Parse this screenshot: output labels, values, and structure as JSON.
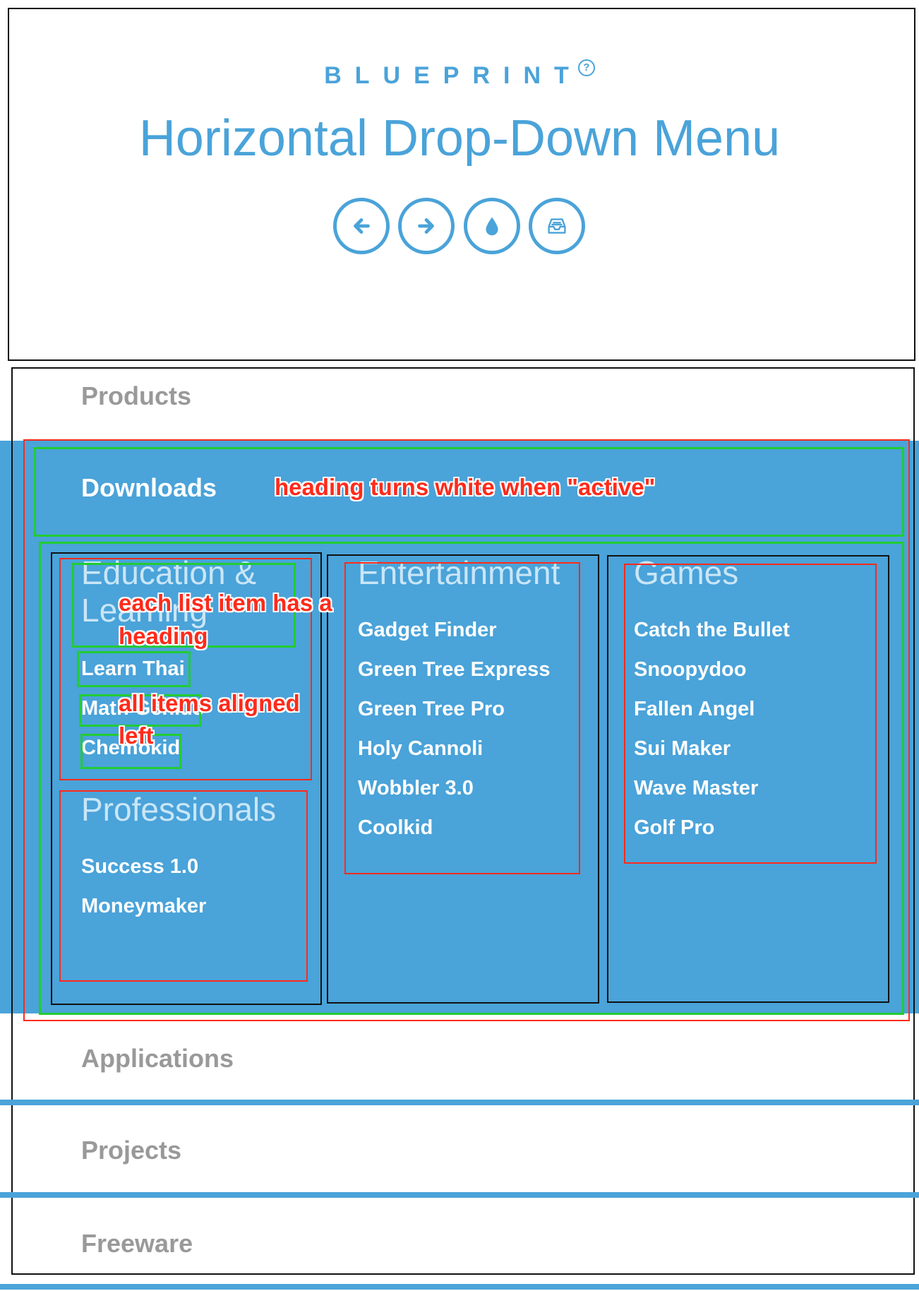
{
  "header": {
    "brand": "BLUEPRINT",
    "brand_sup": "?",
    "title": "Horizontal Drop-Down Menu",
    "nav_icons": [
      "arrow-left-icon",
      "arrow-right-icon",
      "drop-icon",
      "inbox-icon"
    ]
  },
  "menu": {
    "items": [
      {
        "label": "Products"
      },
      {
        "label": "Downloads"
      },
      {
        "label": "Applications"
      },
      {
        "label": "Projects"
      },
      {
        "label": "Freeware"
      }
    ]
  },
  "dropdown": {
    "columns": [
      {
        "groups": [
          {
            "heading": "Education & Learning",
            "links": [
              "Learn Thai",
              "Math Genius",
              "Chemokid"
            ]
          },
          {
            "heading": "Professionals",
            "links": [
              "Success 1.0",
              "Moneymaker"
            ]
          }
        ]
      },
      {
        "groups": [
          {
            "heading": "Entertainment",
            "links": [
              "Gadget Finder",
              "Green Tree Express",
              "Green Tree Pro",
              "Holy Cannoli",
              "Wobbler 3.0",
              "Coolkid"
            ]
          }
        ]
      },
      {
        "groups": [
          {
            "heading": "Games",
            "links": [
              "Catch the Bullet",
              "Snoopydoo",
              "Fallen Angel",
              "Sui Maker",
              "Wave Master",
              "Golf Pro"
            ]
          }
        ]
      }
    ]
  },
  "annotations": {
    "heading_active": "heading turns white when \"active\"",
    "list_heading_1": "each list item has a",
    "list_heading_2": "heading",
    "aligned_1": "all items aligned",
    "aligned_2": "left"
  },
  "colors": {
    "accent": "#4aa3d9",
    "annotation": "#ff2a1a",
    "annotation_box": "#22cc33",
    "menu_label": "#999999"
  }
}
